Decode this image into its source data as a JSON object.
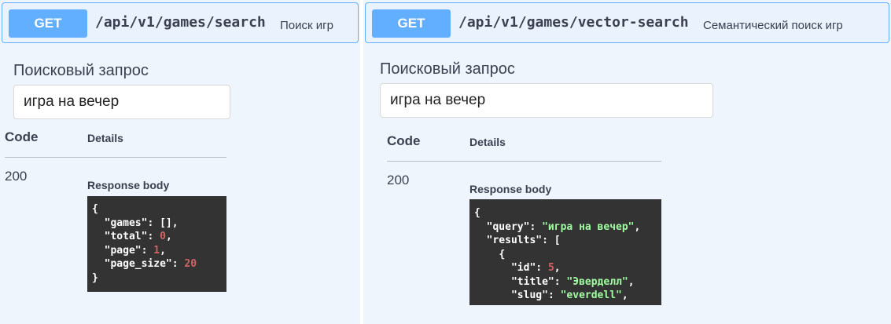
{
  "left": {
    "method": "GET",
    "path": "/api/v1/games/search",
    "summary": "Поиск игр",
    "param_label": "Поисковый запрос",
    "param_value": "игра на вечер",
    "col_code": "Code",
    "col_details": "Details",
    "status": "200",
    "response_label": "Response body",
    "json": {
      "open": "{",
      "l1_key": "\"games\"",
      "l1_val": "[]",
      "l2_key": "\"total\"",
      "l2_val": "0",
      "l3_key": "\"page\"",
      "l3_val": "1",
      "l4_key": "\"page_size\"",
      "l4_val": "20",
      "close": "}"
    }
  },
  "right": {
    "method": "GET",
    "path": "/api/v1/games/vector-search",
    "summary": "Семантический поиск игр",
    "param_label": "Поисковый запрос",
    "param_value": "игра на вечер",
    "col_code": "Code",
    "col_details": "Details",
    "status": "200",
    "response_label": "Response body",
    "json": {
      "open": "{",
      "l1_key": "\"query\"",
      "l1_val": "\"игра на вечер\"",
      "l2_key": "\"results\"",
      "l2_val": "[",
      "l3": "{",
      "l4_key": "\"id\"",
      "l4_val": "5",
      "l5_key": "\"title\"",
      "l5_val": "\"Эверделл\"",
      "l6_key": "\"slug\"",
      "l6_val": "\"everdell\""
    }
  }
}
